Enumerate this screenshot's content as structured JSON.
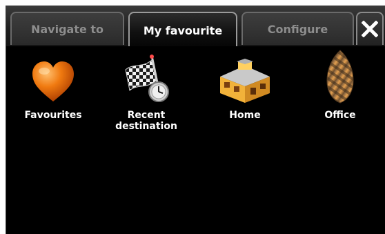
{
  "tabs": [
    {
      "label": "Navigate to",
      "active": false
    },
    {
      "label": "My favourite",
      "active": true
    },
    {
      "label": "Configure",
      "active": false
    }
  ],
  "close_button": {
    "icon": "close-icon"
  },
  "items": [
    {
      "label": "Favourites",
      "icon": "heart-icon",
      "color": "#f07a10"
    },
    {
      "label": "Recent\ndestination",
      "icon": "checkered-flag-clock-icon"
    },
    {
      "label": "Home",
      "icon": "house-icon",
      "color": "#f2b23a"
    },
    {
      "label": "Office",
      "icon": "office-tower-icon",
      "color": "#d98a3a"
    }
  ]
}
